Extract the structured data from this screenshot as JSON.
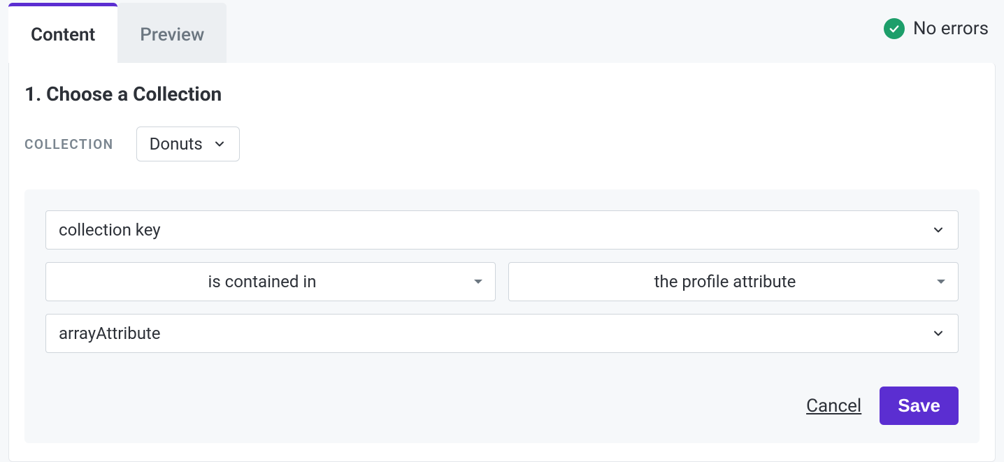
{
  "tabs": {
    "content": "Content",
    "preview": "Preview"
  },
  "status": {
    "text": "No errors"
  },
  "section": {
    "heading": "1. Choose a Collection"
  },
  "collection": {
    "label": "COLLECTION",
    "selected": "Donuts"
  },
  "filters": {
    "field": "collection key",
    "operator": "is contained in",
    "source": "the profile attribute",
    "attribute": "arrayAttribute"
  },
  "actions": {
    "cancel": "Cancel",
    "save": "Save"
  },
  "colors": {
    "accent": "#5b2ed1",
    "success": "#1d9e6a"
  }
}
